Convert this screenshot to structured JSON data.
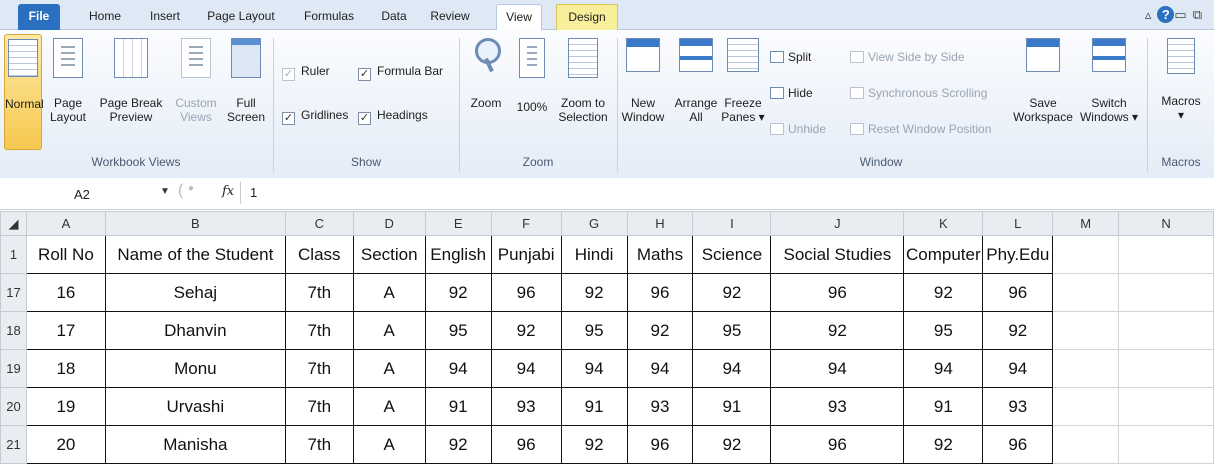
{
  "tabs": [
    "File",
    "Home",
    "Insert",
    "Page Layout",
    "Formulas",
    "Data",
    "Review",
    "View",
    "Design"
  ],
  "active_tab": "View",
  "ribbon": {
    "workbook_views": {
      "label": "Workbook Views",
      "normal": "Normal",
      "page_layout": [
        "Page",
        "Layout"
      ],
      "page_break": [
        "Page Break",
        "Preview"
      ],
      "custom_views": [
        "Custom",
        "Views"
      ],
      "full_screen": [
        "Full",
        "Screen"
      ]
    },
    "show": {
      "label": "Show",
      "ruler": "Ruler",
      "gridlines": "Gridlines",
      "formula_bar": "Formula Bar",
      "headings": "Headings"
    },
    "zoom": {
      "label": "Zoom",
      "zoom": "Zoom",
      "hundred": "100%",
      "zoom_selection": [
        "Zoom to",
        "Selection"
      ]
    },
    "window": {
      "label": "Window",
      "new_window": [
        "New",
        "Window"
      ],
      "arrange_all": [
        "Arrange",
        "All"
      ],
      "freeze_panes": [
        "Freeze",
        "Panes ▾"
      ],
      "split": "Split",
      "hide": "Hide",
      "unhide": "Unhide",
      "side_by_side": "View Side by Side",
      "sync_scroll": "Synchronous Scrolling",
      "reset_pos": "Reset Window Position",
      "save_workspace": [
        "Save",
        "Workspace"
      ],
      "switch_windows": [
        "Switch",
        "Windows ▾"
      ]
    },
    "macros": {
      "label": "Macros",
      "macros": "Macros"
    }
  },
  "formula_bar": {
    "name_box": "A2",
    "fx": "fx",
    "value": "1"
  },
  "grid": {
    "columns": [
      "A",
      "B",
      "C",
      "D",
      "E",
      "F",
      "G",
      "H",
      "I",
      "J",
      "K",
      "L",
      "M",
      "N"
    ],
    "header_row_num": "1",
    "headers": [
      "Roll No",
      "Name of the Student",
      "Class",
      "Section",
      "English",
      "Punjabi",
      "Hindi",
      "Maths",
      "Science",
      "Social Studies",
      "Computer",
      "Phy.Edu"
    ],
    "rows": [
      {
        "num": "17",
        "cells": [
          "16",
          "Sehaj",
          "7th",
          "A",
          "92",
          "96",
          "92",
          "96",
          "92",
          "96",
          "92",
          "96"
        ]
      },
      {
        "num": "18",
        "cells": [
          "17",
          "Dhanvin",
          "7th",
          "A",
          "95",
          "92",
          "95",
          "92",
          "95",
          "92",
          "95",
          "92"
        ]
      },
      {
        "num": "19",
        "cells": [
          "18",
          "Monu",
          "7th",
          "A",
          "94",
          "94",
          "94",
          "94",
          "94",
          "94",
          "94",
          "94"
        ]
      },
      {
        "num": "20",
        "cells": [
          "19",
          "Urvashi",
          "7th",
          "A",
          "91",
          "93",
          "91",
          "93",
          "91",
          "93",
          "91",
          "93"
        ]
      },
      {
        "num": "21",
        "cells": [
          "20",
          "Manisha",
          "7th",
          "A",
          "92",
          "96",
          "92",
          "96",
          "92",
          "96",
          "92",
          "96"
        ]
      }
    ]
  }
}
